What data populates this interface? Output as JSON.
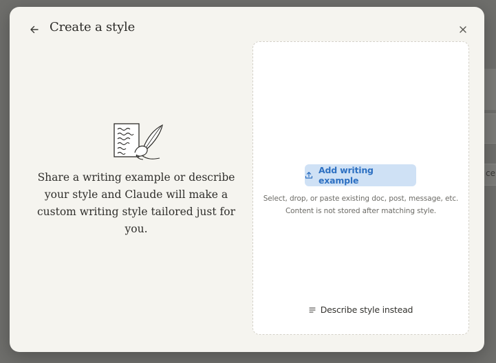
{
  "backdrop": {
    "partial_text": "ce"
  },
  "modal": {
    "title": "Create a style",
    "back_icon": "arrow-left-icon",
    "close_icon": "close-icon"
  },
  "left_pane": {
    "illustration_icon": "writing-quill-illustration",
    "description": "Share a writing example or describe your style and Claude will make a custom writing style tailored just for you."
  },
  "dropzone": {
    "add_button_label": "Add writing example",
    "add_button_icon": "upload-icon",
    "helper_line_1": "Select, drop, or paste existing doc, post, message, etc.",
    "helper_line_2": "Content is not stored after matching style.",
    "describe_button_label": "Describe style instead",
    "describe_button_icon": "text-lines-icon"
  },
  "colors": {
    "accent_button_bg": "#cfe1f5",
    "accent_button_text": "#2d70c2",
    "modal_bg": "#f5f4ef",
    "dropzone_bg": "#ffffff"
  }
}
